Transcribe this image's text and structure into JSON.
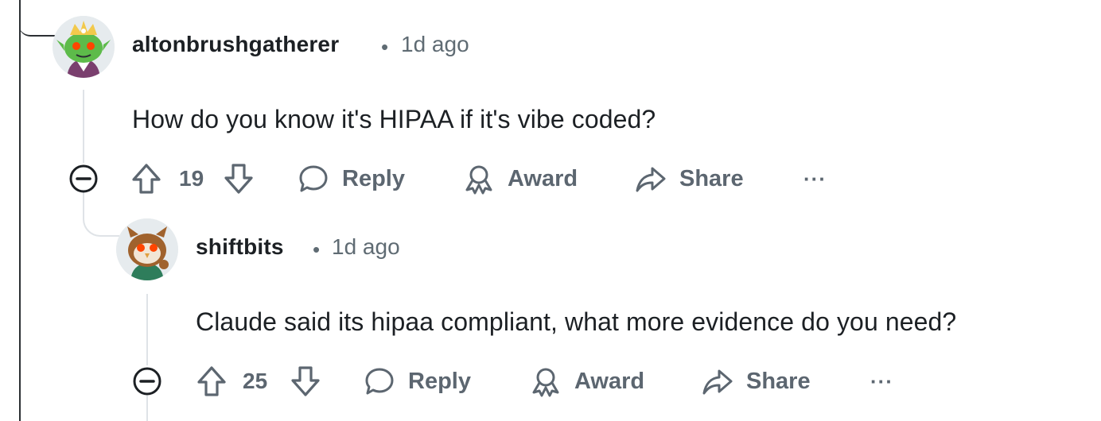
{
  "comments": [
    {
      "username": "altonbrushgatherer",
      "separator": "•",
      "time": "1d ago",
      "text": "How do you know it's HIPAA if it's vibe coded?",
      "votes": "19",
      "reply_label": "Reply",
      "award_label": "Award",
      "share_label": "Share",
      "more_label": "···",
      "avatar_icon": "snoo-avatar-green-icon"
    },
    {
      "username": "shiftbits",
      "separator": "•",
      "time": "1d ago",
      "text": "Claude said its hipaa compliant, what more evidence do you need?",
      "votes": "25",
      "reply_label": "Reply",
      "award_label": "Award",
      "share_label": "Share",
      "more_label": "···",
      "avatar_icon": "snoo-avatar-owl-icon"
    }
  ],
  "colors": {
    "text_primary": "#1c2024",
    "text_secondary": "#5c6670",
    "thread_line": "#dfe3e7",
    "rail_dark": "#2b2f33"
  }
}
